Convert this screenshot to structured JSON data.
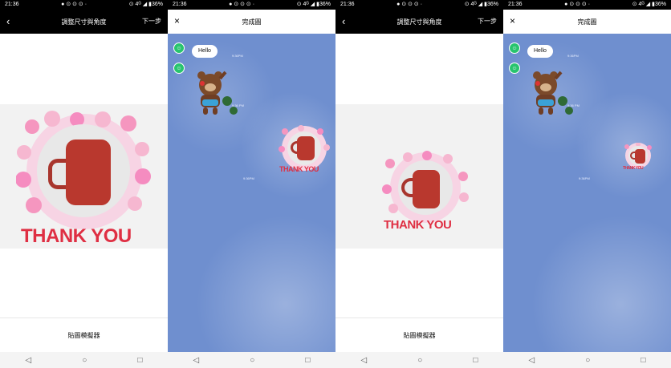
{
  "status": {
    "time": "21:36",
    "left_icons": "● ⊙ ⊙ ⊙ ·",
    "right_info": "⊙ 4ᴳ ◢ ▮36%"
  },
  "screen1": {
    "title": "調整尺寸與角度",
    "next_label": "下一步",
    "bottom_label": "貼圖模擬器",
    "back_icon": "‹"
  },
  "screen2": {
    "title": "完成圖",
    "close_icon": "×",
    "hello": "Hello",
    "time1": "9:36PM",
    "time2": "9:36 PM",
    "time3": "9:36PM"
  },
  "screen3": {
    "title": "調整尺寸與角度",
    "next_label": "下一步",
    "bottom_label": "貼圖模擬器",
    "back_icon": "‹"
  },
  "screen4": {
    "title": "完成圖",
    "close_icon": "×",
    "hello": "Hello",
    "time1": "9:36PM",
    "time2": "9:36 PM",
    "time3": "9:36PM"
  },
  "sticker": {
    "text": "THANK YOU"
  },
  "navbar": {
    "back": "◁",
    "home": "○",
    "recent": "□"
  }
}
